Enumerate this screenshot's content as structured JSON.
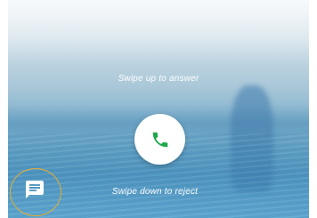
{
  "incoming_call": {
    "swipe_up_hint": "Swipe up to answer",
    "swipe_down_hint": "Swipe down to reject",
    "answer_icon": "phone-icon",
    "message_icon": "message-icon"
  },
  "colors": {
    "answer_icon": "#1fa84b",
    "highlight_ring": "#e5ad33",
    "hint_text": "#ffffff"
  }
}
